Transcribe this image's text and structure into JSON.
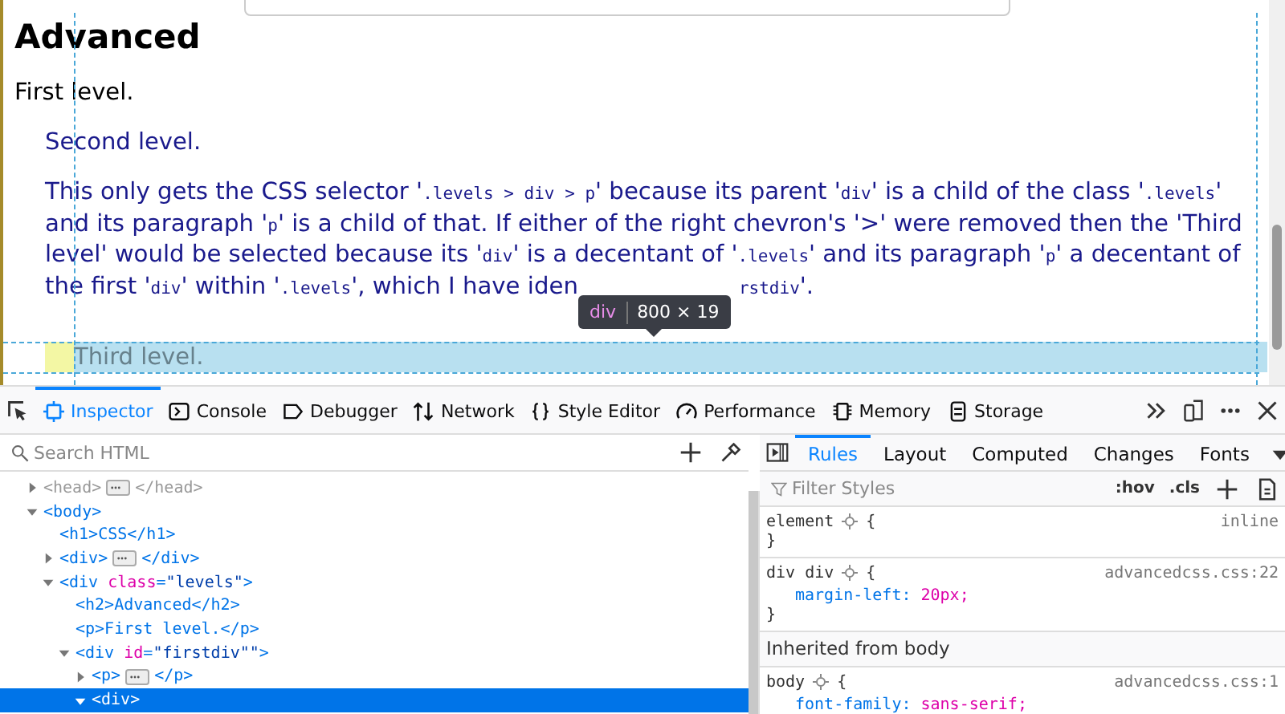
{
  "page": {
    "heading": "Advanced",
    "first": "First level.",
    "second": "Second level.",
    "paragraph": [
      {
        "kind": "text",
        "text": "This only gets the CSS selector '"
      },
      {
        "kind": "code",
        "text": ".levels > div > p"
      },
      {
        "kind": "text",
        "text": "' because its parent '"
      },
      {
        "kind": "code",
        "text": "div"
      },
      {
        "kind": "text",
        "text": "' is a child of the class '"
      },
      {
        "kind": "code",
        "text": ".levels"
      },
      {
        "kind": "text",
        "text": "' and its paragraph '"
      },
      {
        "kind": "code",
        "text": "p"
      },
      {
        "kind": "text",
        "text": "' is a child of that. If either of the right chevron's '>' were removed then the 'Third level' would be selected because its '"
      },
      {
        "kind": "code",
        "text": "div"
      },
      {
        "kind": "text",
        "text": "' is a decentant of '"
      },
      {
        "kind": "code",
        "text": ".levels"
      },
      {
        "kind": "text",
        "text": "' and its paragraph '"
      },
      {
        "kind": "code",
        "text": "p"
      },
      {
        "kind": "text",
        "text": "' a decentant of the first '"
      },
      {
        "kind": "code",
        "text": "div"
      },
      {
        "kind": "text",
        "text": "' within '"
      },
      {
        "kind": "code",
        "text": ".levels"
      },
      {
        "kind": "text",
        "text": "', which I have iden"
      },
      {
        "kind": "covered"
      },
      {
        "kind": "code",
        "text": "rstdiv"
      },
      {
        "kind": "text",
        "text": "'."
      }
    ],
    "third": "Third level.",
    "tooltip": {
      "tag": "div",
      "size": "800 × 19"
    }
  },
  "toolbar": {
    "tabs": [
      {
        "label": "Inspector",
        "selected": true
      },
      {
        "label": "Console",
        "selected": false
      },
      {
        "label": "Debugger",
        "selected": false
      },
      {
        "label": "Network",
        "selected": false
      },
      {
        "label": "Style Editor",
        "selected": false
      },
      {
        "label": "Performance",
        "selected": false
      },
      {
        "label": "Memory",
        "selected": false
      },
      {
        "label": "Storage",
        "selected": false
      }
    ]
  },
  "markup": {
    "search": {
      "placeholder": "Search HTML"
    },
    "nodes": [
      {
        "parts": [
          {
            "kind": "tag",
            "text": "<head>"
          },
          {
            "kind": "more"
          },
          {
            "kind": "tag",
            "text": "</head>"
          }
        ],
        "dim": true,
        "expanded": false,
        "selected": false
      },
      {
        "parts": [
          {
            "kind": "tag",
            "text": "<body>"
          }
        ],
        "dim": false,
        "expanded": true,
        "selected": false,
        "children": [
          {
            "parts": [
              {
                "kind": "tag",
                "text": "<h1>CSS</h1>"
              }
            ],
            "dim": false,
            "selected": false
          },
          {
            "parts": [
              {
                "kind": "tag",
                "text": "<div>"
              },
              {
                "kind": "more"
              },
              {
                "kind": "tag",
                "text": "</div>"
              }
            ],
            "dim": false,
            "expanded": false,
            "selected": false
          },
          {
            "parts": [
              {
                "kind": "tag",
                "text": "<div "
              },
              {
                "kind": "attr",
                "text": "class"
              },
              {
                "kind": "tag",
                "text": "="
              },
              {
                "kind": "value",
                "text": "\"levels\""
              },
              {
                "kind": "tag",
                "text": ">"
              }
            ],
            "dim": false,
            "expanded": true,
            "selected": false,
            "children": [
              {
                "parts": [
                  {
                    "kind": "tag",
                    "text": "<h2>Advanced</h2>"
                  }
                ],
                "dim": false,
                "selected": false
              },
              {
                "parts": [
                  {
                    "kind": "tag",
                    "text": "<p>First level.</p>"
                  }
                ],
                "dim": false,
                "selected": false
              },
              {
                "parts": [
                  {
                    "kind": "tag",
                    "text": "<div "
                  },
                  {
                    "kind": "attr",
                    "text": "id"
                  },
                  {
                    "kind": "tag",
                    "text": "="
                  },
                  {
                    "kind": "value",
                    "text": "\"firstdiv\"\""
                  },
                  {
                    "kind": "tag",
                    "text": ">"
                  }
                ],
                "dim": false,
                "expanded": true,
                "selected": false,
                "children": [
                  {
                    "parts": [
                      {
                        "kind": "tag",
                        "text": "<p>"
                      },
                      {
                        "kind": "more"
                      },
                      {
                        "kind": "tag",
                        "text": "</p>"
                      }
                    ],
                    "dim": false,
                    "expanded": false,
                    "selected": false
                  },
                  {
                    "parts": [
                      {
                        "kind": "tag",
                        "text": "<div>"
                      }
                    ],
                    "dim": false,
                    "expanded": true,
                    "selected": true
                  }
                ]
              }
            ]
          }
        ]
      }
    ]
  },
  "rules": {
    "tabs": [
      {
        "label": "Rules",
        "selected": true
      },
      {
        "label": "Layout",
        "selected": false
      },
      {
        "label": "Computed",
        "selected": false
      },
      {
        "label": "Changes",
        "selected": false
      },
      {
        "label": "Fonts",
        "selected": false
      }
    ],
    "filter": {
      "placeholder": "Filter Styles"
    },
    "hov": ":hov",
    "cls": ".cls",
    "blocks": [
      {
        "kind": "rule",
        "selector": "element",
        "open": "{",
        "source": "inline",
        "close": "}"
      },
      {
        "kind": "rule",
        "selector": "div div",
        "open": "{",
        "source": "advancedcss.css:22",
        "decls": [
          {
            "prop": "margin-left:",
            "value": "20px;"
          }
        ],
        "close": "}"
      },
      {
        "kind": "header",
        "text": "Inherited from body"
      },
      {
        "kind": "rule",
        "selector": "body",
        "open": "{",
        "source": "advancedcss.css:1",
        "decls": [
          {
            "prop": "font-family:",
            "value": "sans-serif;"
          }
        ]
      }
    ]
  }
}
